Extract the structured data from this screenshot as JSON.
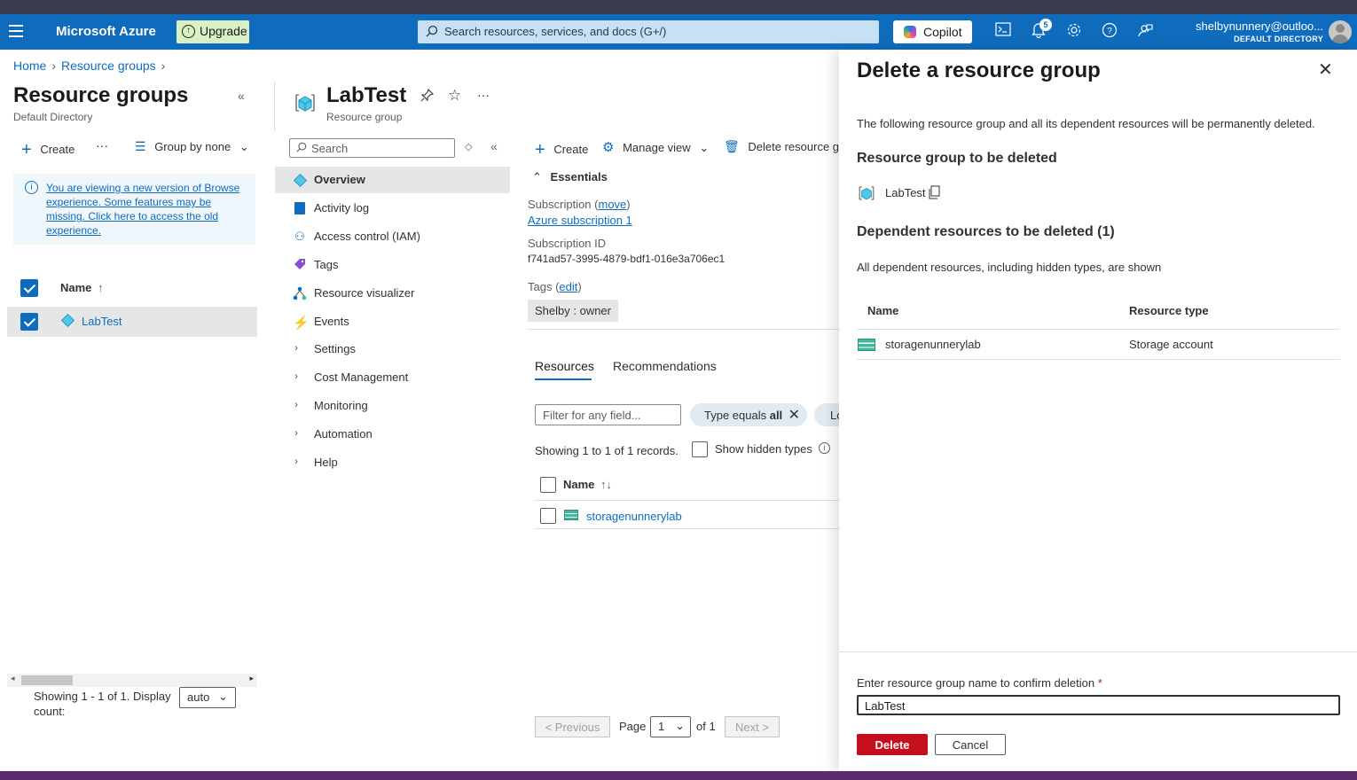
{
  "topbar": {
    "brand": "Microsoft Azure",
    "upgrade_label": "Upgrade",
    "search_placeholder": "Search resources, services, and docs (G+/)",
    "copilot_label": "Copilot",
    "notification_count": "5",
    "account_email": "shelbynunnery@outloo...",
    "account_directory": "DEFAULT DIRECTORY",
    "accent_color": "#0f6cbd"
  },
  "breadcrumb": {
    "home": "Home",
    "resource_groups": "Resource groups"
  },
  "left_pane": {
    "title": "Resource groups",
    "subtitle": "Default Directory",
    "create_label": "Create",
    "more_label": "···",
    "group_by_label": "Group by none",
    "info_text": "You are viewing a new version of Browse experience. Some features may be missing. Click here to access the old experience.",
    "column_name": "Name",
    "sort_indicator": "↑",
    "rows": [
      {
        "name": "LabTest"
      }
    ],
    "footer_text": "Showing 1 - 1 of 1. Display count:",
    "display_count": "auto"
  },
  "resource_group": {
    "title": "LabTest",
    "subtitle": "Resource group",
    "menu_search_placeholder": "Search",
    "menu": [
      {
        "label": "Overview",
        "icon": "cube-icon"
      },
      {
        "label": "Activity log",
        "icon": "activity-log-icon"
      },
      {
        "label": "Access control (IAM)",
        "icon": "people-icon"
      },
      {
        "label": "Tags",
        "icon": "tag-icon"
      },
      {
        "label": "Resource visualizer",
        "icon": "visualizer-icon"
      },
      {
        "label": "Events",
        "icon": "lightning-icon"
      },
      {
        "label": "Settings"
      },
      {
        "label": "Cost Management"
      },
      {
        "label": "Monitoring"
      },
      {
        "label": "Automation"
      },
      {
        "label": "Help"
      }
    ],
    "toolbar": {
      "create": "Create",
      "manage_view": "Manage view",
      "delete": "Delete resource gr"
    },
    "essentials_label": "Essentials",
    "subscription_label": "Subscription",
    "subscription_move": "move",
    "subscription_value": "Azure subscription 1",
    "subscription_id_label": "Subscription ID",
    "subscription_id_value": "f741ad57-3995-4879-bdf1-016e3a706ec1",
    "tags_label": "Tags",
    "tags_edit": "edit",
    "tag_pill": "Shelby : owner",
    "tabs": [
      "Resources",
      "Recommendations"
    ],
    "filter_placeholder": "Filter for any field...",
    "type_filter_prefix": "Type equals ",
    "type_filter_value": "all",
    "location_filter": "Lo",
    "records_text": "Showing 1 to 1 of 1 records.",
    "show_hidden_label": "Show hidden types",
    "table_header": "Name",
    "table_sort": "↑↓",
    "resources": [
      {
        "name": "storagenunnerylab"
      }
    ],
    "pager": {
      "previous": "< Previous",
      "page_label": "Page",
      "page_value": "1",
      "of_label": "of 1",
      "next": "Next >"
    }
  },
  "delete_panel": {
    "title": "Delete a resource group",
    "warning": "The following resource group and all its dependent resources will be permanently deleted.",
    "to_delete_heading": "Resource group to be deleted",
    "rg_name": "LabTest",
    "dependent_heading": "Dependent resources to be deleted (1)",
    "dependent_note": "All dependent resources, including hidden types, are shown",
    "col_name": "Name",
    "col_type": "Resource type",
    "dependents": [
      {
        "name": "storagenunnerylab",
        "type": "Storage account"
      }
    ],
    "confirm_label": "Enter resource group name to confirm deletion",
    "required_mark": "*",
    "confirm_value": "LabTest",
    "delete_button": "Delete",
    "cancel_button": "Cancel",
    "delete_color": "#c50f1f"
  }
}
